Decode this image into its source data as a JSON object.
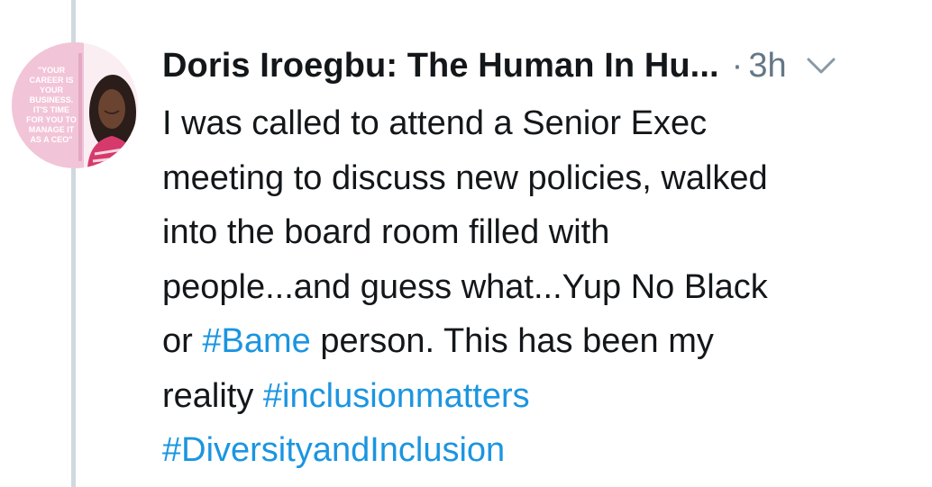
{
  "tweet": {
    "author": "Doris Iroegbu: The Human In Hu...",
    "separator": "·",
    "time": "3h",
    "avatar": {
      "quote_lines": [
        "\"YOUR",
        "CAREER IS",
        "YOUR",
        "BUSINESS.",
        "IT'S TIME",
        "FOR YOU TO",
        "MANAGE IT",
        "AS A CEO\""
      ],
      "colors": {
        "quote_bg": "#f2c4d8",
        "quote_text": "#ffffff",
        "hair": "#2a1d1a",
        "skin": "#6b4331",
        "top": "#d63a6d"
      }
    },
    "body": {
      "line1": "I was called to attend a Senior Exec",
      "line2": "meeting to discuss new policies, walked",
      "line3": "into the board room filled with",
      "line4": "people...and guess what...Yup No Black",
      "line5_pre": "or ",
      "hashtag_bame": "#Bame",
      "line5_post": " person. This has been my",
      "line6_pre": "reality ",
      "hashtag_inclusionmatters": "#inclusionmatters",
      "hashtag_diversity": "#DiversityandInclusion"
    },
    "colors": {
      "text": "#14171a",
      "muted": "#657786",
      "link": "#1b95e0",
      "thread": "#cfd9de"
    }
  }
}
